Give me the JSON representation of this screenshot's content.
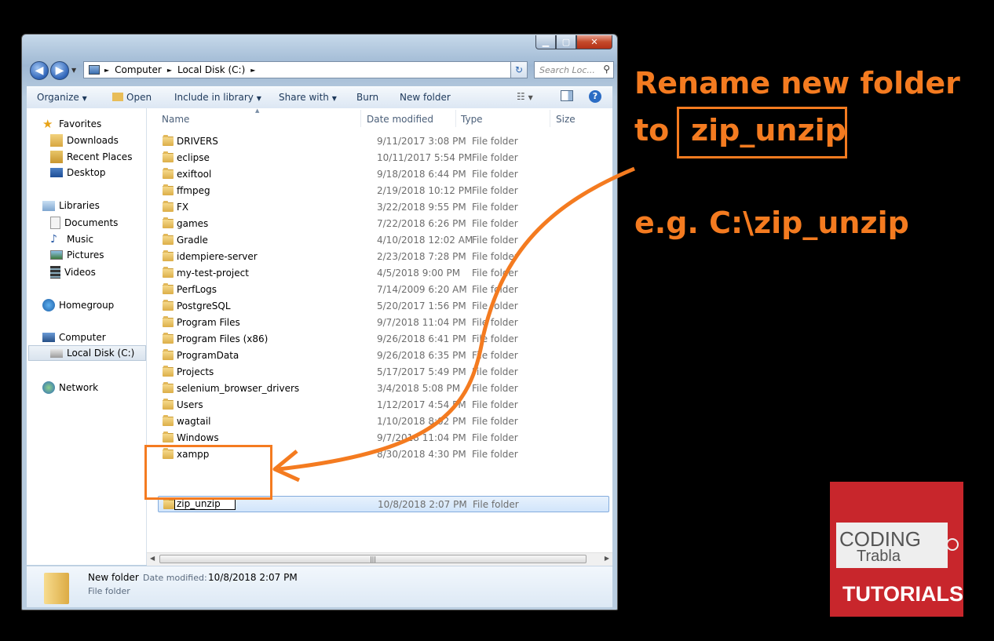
{
  "window": {
    "caption_buttons": {
      "minimize": "▁",
      "maximize": "▢",
      "close": "✕"
    },
    "address": {
      "segments": [
        "Computer",
        "Local Disk (C:)"
      ],
      "separator": "►"
    },
    "search_placeholder": "Search Loc..."
  },
  "toolbar": {
    "organize": "Organize",
    "open": "Open",
    "include_in_library": "Include in library",
    "share_with": "Share with",
    "burn": "Burn",
    "new_folder": "New folder"
  },
  "nav": {
    "favorites": "Favorites",
    "downloads": "Downloads",
    "recent_places": "Recent Places",
    "desktop": "Desktop",
    "libraries": "Libraries",
    "documents": "Documents",
    "music": "Music",
    "pictures": "Pictures",
    "videos": "Videos",
    "homegroup": "Homegroup",
    "computer": "Computer",
    "local_disk": "Local Disk (C:)",
    "network": "Network"
  },
  "columns": {
    "name": "Name",
    "date_modified": "Date modified",
    "type": "Type",
    "size": "Size"
  },
  "files": [
    {
      "name": "DRIVERS",
      "date": "9/11/2017 3:08 PM",
      "type": "File folder"
    },
    {
      "name": "eclipse",
      "date": "10/11/2017 5:54 PM",
      "type": "File folder"
    },
    {
      "name": "exiftool",
      "date": "9/18/2018 6:44 PM",
      "type": "File folder"
    },
    {
      "name": "ffmpeg",
      "date": "2/19/2018 10:12 PM",
      "type": "File folder"
    },
    {
      "name": "FX",
      "date": "3/22/2018 9:55 PM",
      "type": "File folder"
    },
    {
      "name": "games",
      "date": "7/22/2018 6:26 PM",
      "type": "File folder"
    },
    {
      "name": "Gradle",
      "date": "4/10/2018 12:02 AM",
      "type": "File folder"
    },
    {
      "name": "idempiere-server",
      "date": "2/23/2018 7:28 PM",
      "type": "File folder"
    },
    {
      "name": "my-test-project",
      "date": "4/5/2018 9:00 PM",
      "type": "File folder"
    },
    {
      "name": "PerfLogs",
      "date": "7/14/2009 6:20 AM",
      "type": "File folder"
    },
    {
      "name": "PostgreSQL",
      "date": "5/20/2017 1:56 PM",
      "type": "File folder"
    },
    {
      "name": "Program Files",
      "date": "9/7/2018 11:04 PM",
      "type": "File folder"
    },
    {
      "name": "Program Files (x86)",
      "date": "9/26/2018 6:41 PM",
      "type": "File folder"
    },
    {
      "name": "ProgramData",
      "date": "9/26/2018 6:35 PM",
      "type": "File folder"
    },
    {
      "name": "Projects",
      "date": "5/17/2017 5:49 PM",
      "type": "File folder"
    },
    {
      "name": "selenium_browser_drivers",
      "date": "3/4/2018 5:08 PM",
      "type": "File folder"
    },
    {
      "name": "Users",
      "date": "1/12/2017 4:54 PM",
      "type": "File folder"
    },
    {
      "name": "wagtail",
      "date": "1/10/2018 8:02 PM",
      "type": "File folder"
    },
    {
      "name": "Windows",
      "date": "9/7/2018 11:04 PM",
      "type": "File folder"
    },
    {
      "name": "xampp",
      "date": "8/30/2018 4:30 PM",
      "type": "File folder"
    }
  ],
  "renaming": {
    "value": "zip_unzip",
    "date": "10/8/2018 2:07 PM",
    "type": "File folder"
  },
  "details": {
    "name": "New folder",
    "date_label": "Date modified:",
    "date_value": "10/8/2018 2:07 PM",
    "type": "File folder"
  },
  "annotation": {
    "line1": "Rename  new folder",
    "line2_prefix": "to",
    "line2_boxed": "zip_unzip",
    "example": "e.g. C:\\zip_unzip",
    "color": "#f47b20"
  },
  "logo": {
    "line1": "CODING",
    "line2": "Trabla",
    "line3": "TUTORIALS",
    "color": "#c8262c"
  }
}
